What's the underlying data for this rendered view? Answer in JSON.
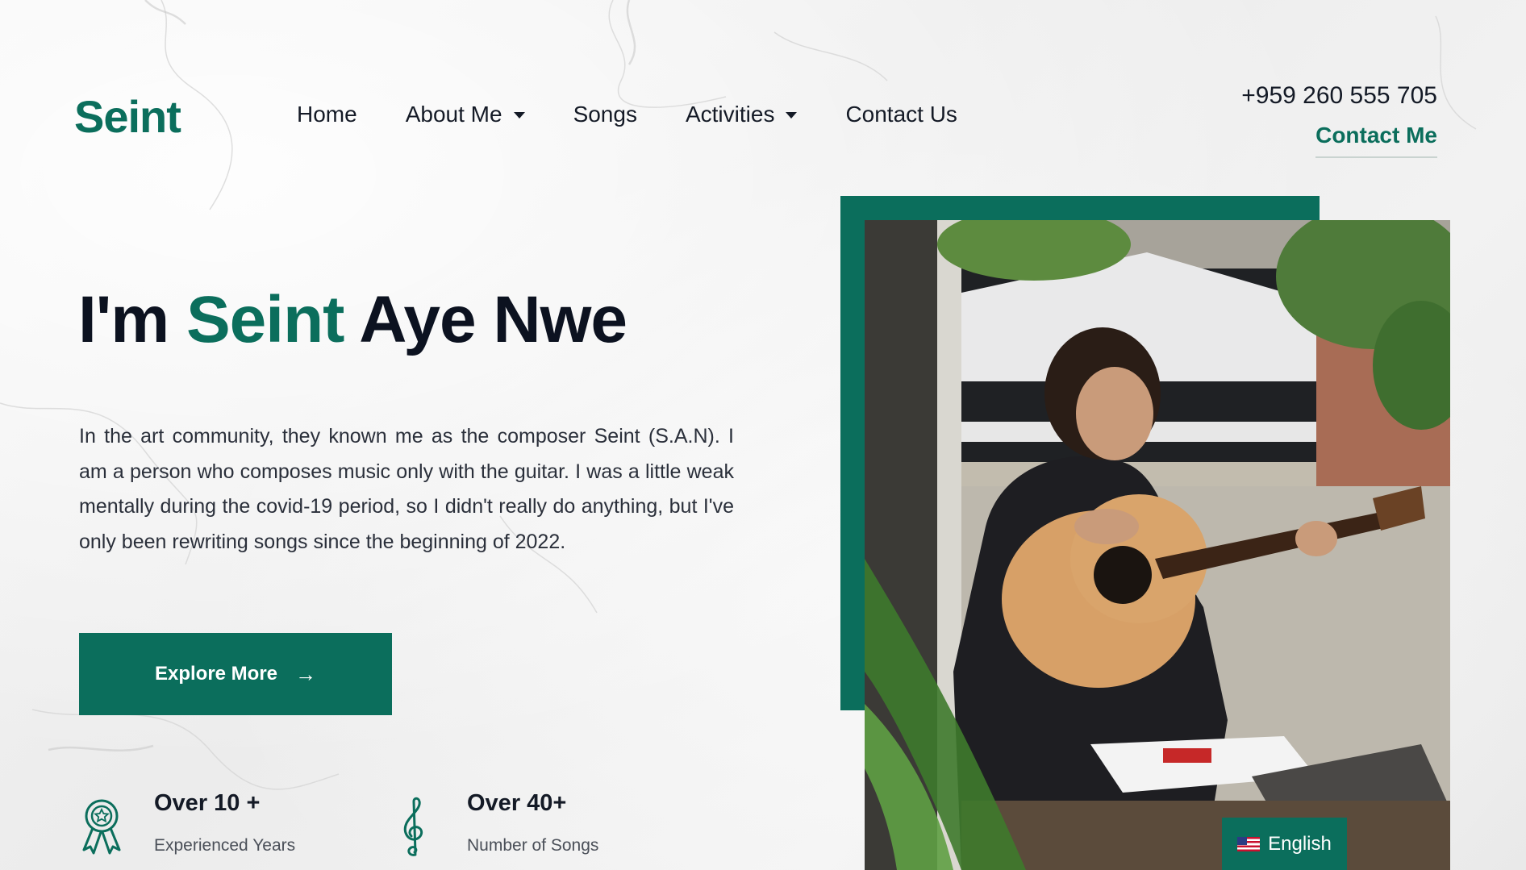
{
  "brand": {
    "logo": "Seint"
  },
  "nav": {
    "items": [
      {
        "label": "Home"
      },
      {
        "label": "About Me"
      },
      {
        "label": "Songs"
      },
      {
        "label": "Activities"
      },
      {
        "label": "Contact Us"
      }
    ]
  },
  "header": {
    "phone": "+959 260 555 705",
    "contact_link": "Contact Me"
  },
  "hero": {
    "title_prefix": "I'm ",
    "title_accent": "Seint",
    "title_suffix": " Aye Nwe",
    "intro": "In the art community, they known me as the composer Seint (S.A.N). I am a person who composes music only with the guitar. I was a little weak mentally during the covid-19 period, so I didn't really do anything, but I've only been rewriting songs since the beginning of 2022.",
    "button_label": "Explore More"
  },
  "stats": [
    {
      "title": "Over 10 +",
      "subtitle": "Experienced Years",
      "icon": "award-ribbon-icon"
    },
    {
      "title": "Over 40+",
      "subtitle": "Number of Songs",
      "icon": "treble-clef-icon"
    }
  ],
  "language": {
    "label": "English",
    "flag": "us-flag-icon"
  },
  "colors": {
    "accent": "#0b6e5c",
    "text": "#141a26",
    "background": "#efefef"
  }
}
